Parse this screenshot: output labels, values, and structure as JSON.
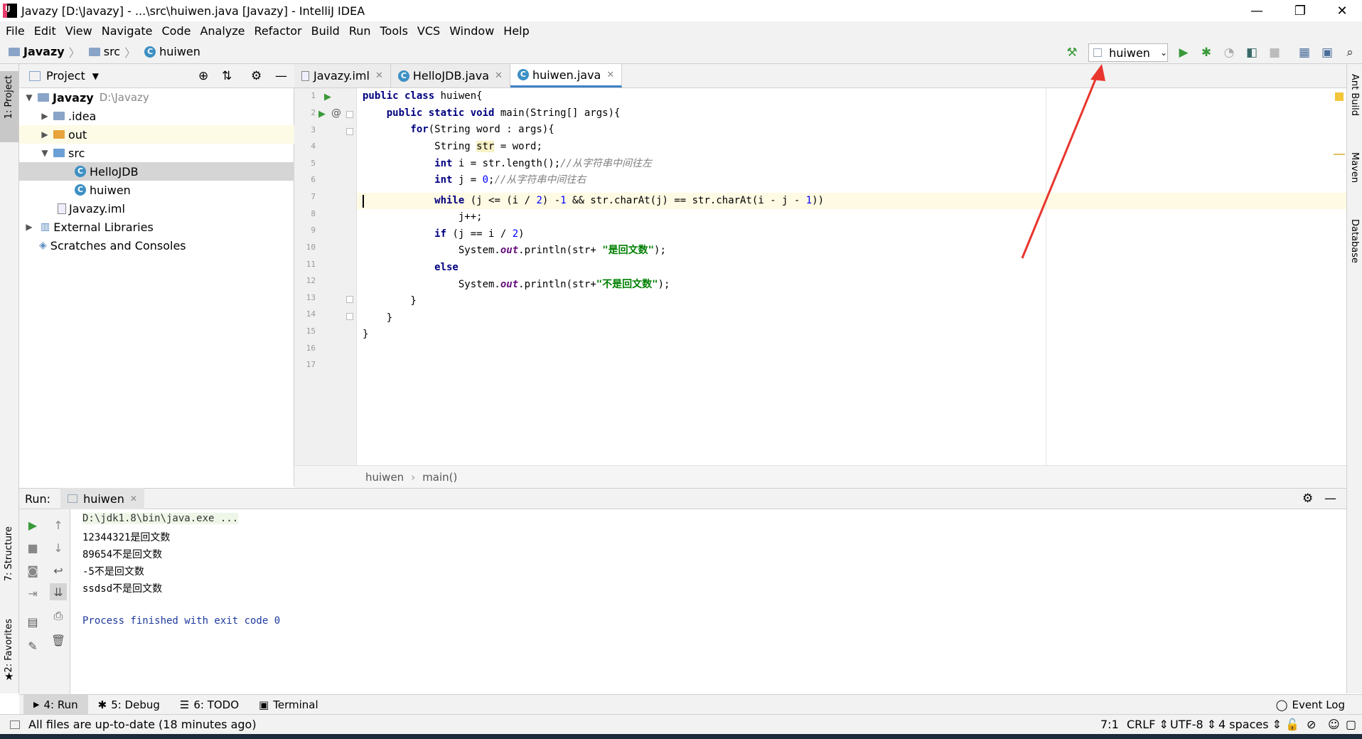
{
  "window": {
    "title": "Javazy [D:\\Javazy] - ...\\src\\huiwen.java [Javazy] - IntelliJ IDEA",
    "minimize": "—",
    "restore": "❐",
    "close": "✕"
  },
  "menu": [
    "File",
    "Edit",
    "View",
    "Navigate",
    "Code",
    "Analyze",
    "Refactor",
    "Build",
    "Run",
    "Tools",
    "VCS",
    "Window",
    "Help"
  ],
  "nav": {
    "project": "Javazy",
    "folder": "src",
    "file": "huiwen"
  },
  "toolbar": {
    "run_config": "huiwen"
  },
  "project_panel": {
    "title": "Project",
    "items": [
      {
        "label": "Javazy",
        "path": "D:\\Javazy"
      },
      {
        "label": ".idea"
      },
      {
        "label": "out"
      },
      {
        "label": "src"
      },
      {
        "label": "HelloJDB"
      },
      {
        "label": "huiwen"
      },
      {
        "label": "Javazy.iml"
      },
      {
        "label": "External Libraries"
      },
      {
        "label": "Scratches and Consoles"
      }
    ]
  },
  "left_strip": {
    "project": "1: Project",
    "structure": "7: Structure",
    "favorites": "2: Favorites"
  },
  "right_strip": {
    "ant": "Ant Build",
    "maven": "Maven",
    "database": "Database"
  },
  "tabs": [
    {
      "label": "Javazy.iml"
    },
    {
      "label": "HelloJDB.java"
    },
    {
      "label": "huiwen.java"
    }
  ],
  "line_numbers": [
    "1",
    "2",
    "3",
    "4",
    "5",
    "6",
    "7",
    "8",
    "9",
    "10",
    "11",
    "12",
    "13",
    "14",
    "15",
    "16",
    "17"
  ],
  "code": {
    "l1a": "public class",
    "l1b": " huiwen{",
    "l2a": "    public static void",
    "l2b": " main(String[] args){",
    "l3a": "        for",
    "l3b": "(String word : args){",
    "l4a": "            String ",
    "l4b": "str",
    "l4c": " = word;",
    "l5a": "            int",
    "l5b": " i = str.length();",
    "l5c": "//从字符串中间往左",
    "l6a": "            int",
    "l6b": " j = ",
    "l6c": "0",
    "l6d": ";",
    "l6e": "//从字符串中间往右",
    "l7a": "            while",
    "l7b": " (j <= (i / ",
    "l7c": "2",
    "l7d": ") -",
    "l7e": "1",
    "l7f": " && str.charAt(j) == str.charAt(i - j - ",
    "l7g": "1",
    "l7h": "))",
    "l8": "                j++;",
    "l9a": "            if",
    "l9b": " (j == i / ",
    "l9c": "2",
    "l9d": ")",
    "l10a": "                System.",
    "l10b": "out",
    "l10c": ".println(str+ ",
    "l10d": "\"是回文数\"",
    "l10e": ");",
    "l11": "            else",
    "l12a": "                System.",
    "l12b": "out",
    "l12c": ".println(str+",
    "l12d": "\"不是回文数\"",
    "l12e": ");",
    "l13": "        }",
    "l14": "    }",
    "l15": "}"
  },
  "editor_breadcrumb": {
    "class": "huiwen",
    "method": "main()"
  },
  "run_panel": {
    "label": "Run:",
    "tab": "huiwen",
    "console": [
      "D:\\jdk1.8\\bin\\java.exe ...",
      "12344321是回文数",
      "89654不是回文数",
      "-5不是回文数",
      "ssdsd不是回文数",
      "",
      "Process finished with exit code 0"
    ]
  },
  "bottom_tabs": [
    {
      "label": "4: Run"
    },
    {
      "label": "5: Debug"
    },
    {
      "label": "6: TODO"
    },
    {
      "label": "Terminal"
    }
  ],
  "event_log": "Event Log",
  "status": {
    "message": "All files are up-to-date (18 minutes ago)",
    "position": "7:1",
    "line_sep": "CRLF",
    "encoding": "UTF-8",
    "indent": "4 spaces"
  },
  "colors": {
    "keyword": "#000080",
    "string": "#008000",
    "comment": "#808080",
    "number": "#0000ff",
    "annotation_arrow": "#e8352e"
  }
}
